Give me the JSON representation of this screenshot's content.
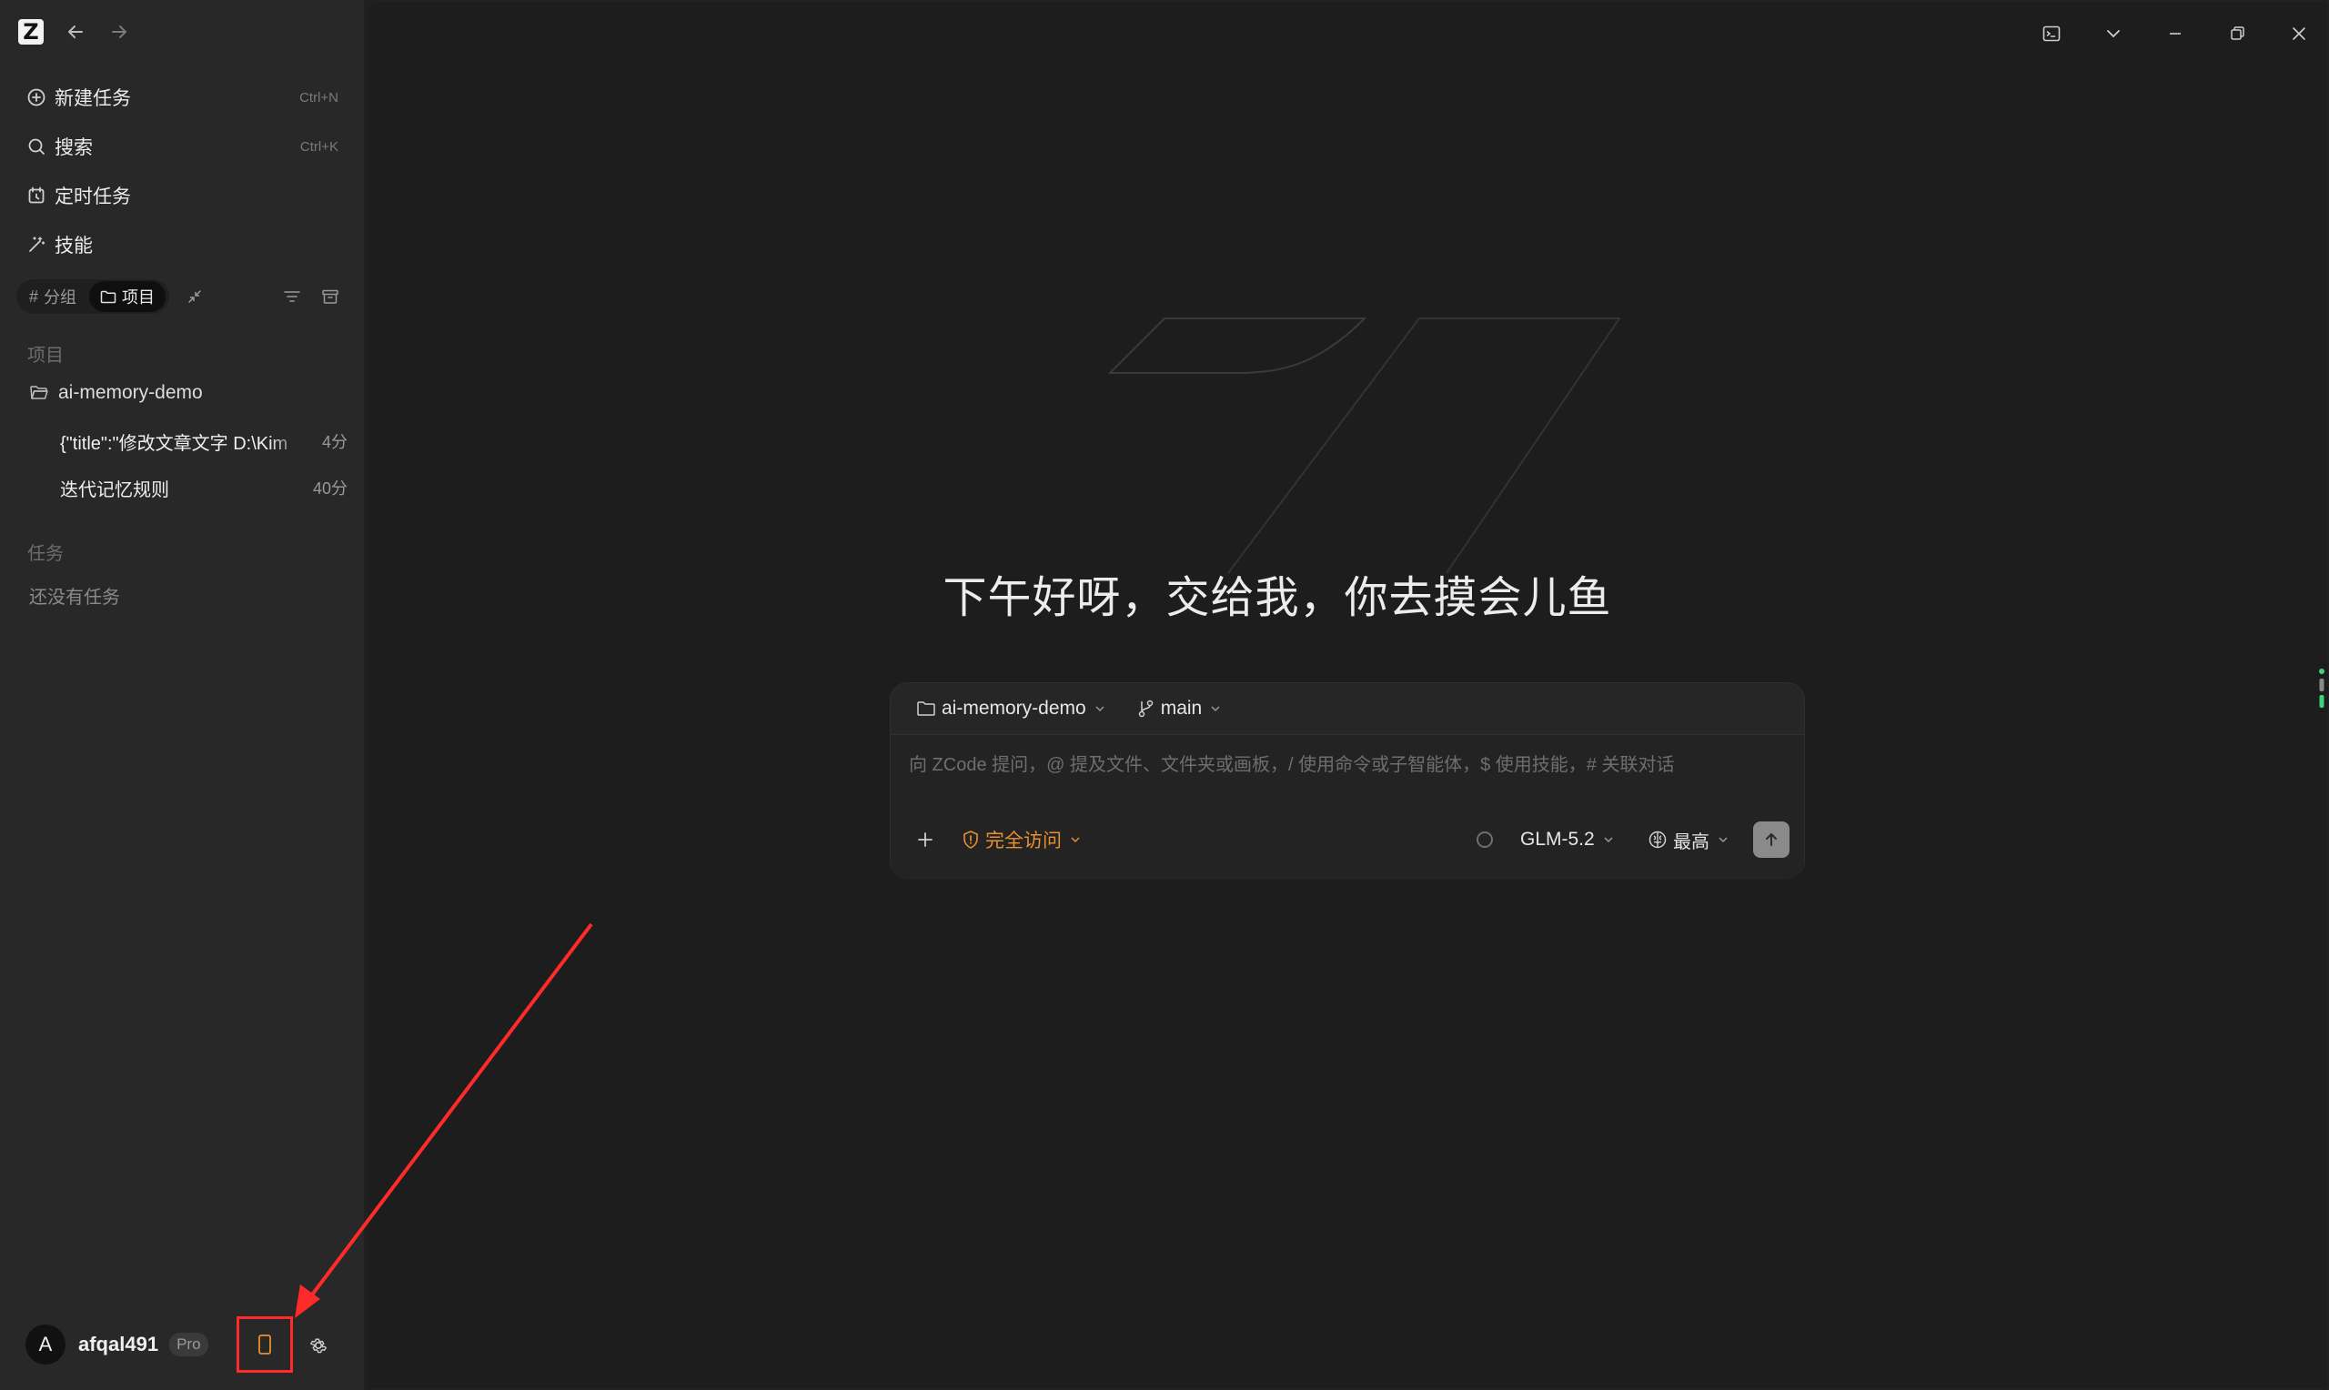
{
  "app": {
    "logo_letter": "Z"
  },
  "sidebar": {
    "menu": [
      {
        "label": "新建任务",
        "shortcut": "Ctrl+N",
        "icon": "plus-circle-icon"
      },
      {
        "label": "搜索",
        "shortcut": "Ctrl+K",
        "icon": "search-icon"
      },
      {
        "label": "定时任务",
        "shortcut": "",
        "icon": "alarm-clock-icon"
      },
      {
        "label": "技能",
        "shortcut": "",
        "icon": "magic-wand-icon"
      }
    ],
    "view_toggle": {
      "group_label": "分组",
      "project_label": "项目",
      "active": "项目"
    },
    "projects_section_title": "项目",
    "project": {
      "name": "ai-memory-demo",
      "tasks": [
        {
          "title": "{\"title\":\"修改文章文字 D:\\Kim",
          "time": "4分"
        },
        {
          "title": "迭代记忆规则",
          "time": "40分"
        }
      ]
    },
    "tasks_section_title": "任务",
    "tasks_empty_text": "还没有任务",
    "user": {
      "avatar_letter": "A",
      "name": "afqal491",
      "plan": "Pro"
    }
  },
  "main": {
    "greeting": "下午好呀，交给我，你去摸会儿鱼",
    "composer": {
      "project": "ai-memory-demo",
      "branch": "main",
      "placeholder": "向 ZCode 提问，@ 提及文件、文件夹或画板，/ 使用命令或子智能体，$ 使用技能，# 关联对话",
      "access_mode": "完全访问",
      "model": "GLM-5.2",
      "effort": "最高"
    }
  },
  "colors": {
    "sidebar_bg": "#282828",
    "main_bg": "#1d1d1d",
    "access_orange": "#e8902e",
    "highlight_red": "#ff2a2a",
    "scroll_green": "#3fd17c"
  }
}
